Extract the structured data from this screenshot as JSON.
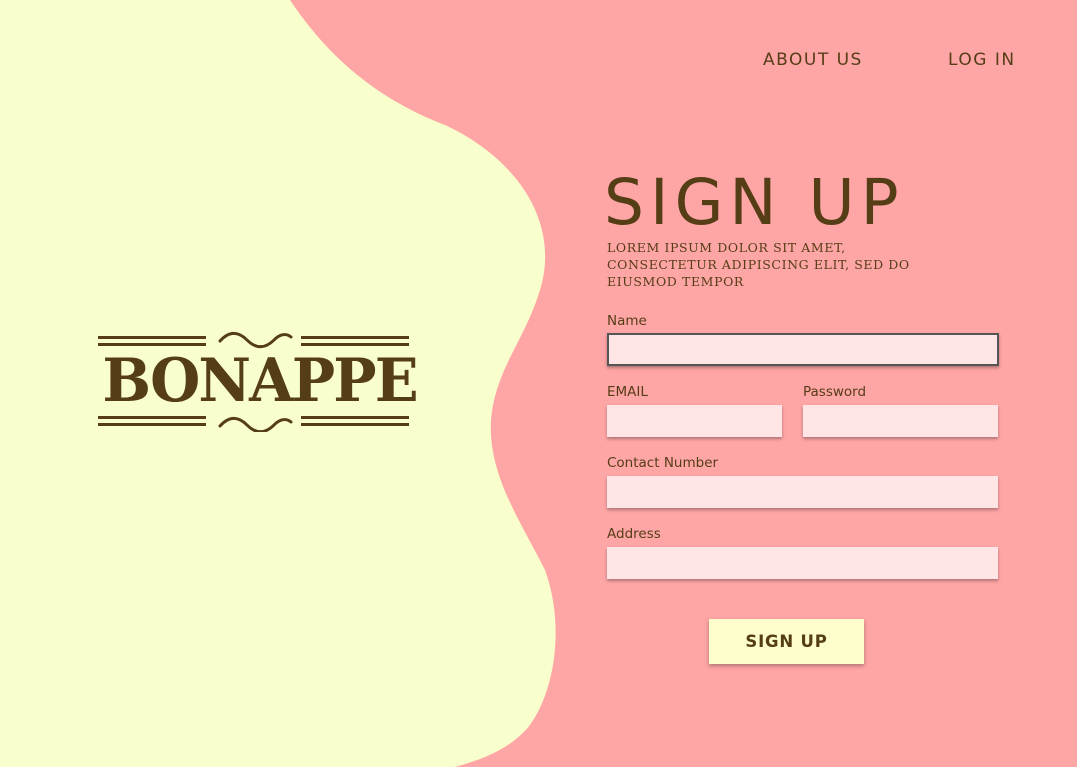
{
  "colors": {
    "background": "#fea5a5",
    "blob": "#f8fecc",
    "text": "#553d16",
    "field": "#ffe5e5",
    "button": "#fdfecc"
  },
  "logo": {
    "text": "BONAPPE"
  },
  "nav": {
    "about": "ABOUT US",
    "login": "LOG IN"
  },
  "heading": {
    "title": "SIGN UP",
    "subtitle": "Lorem ipsum dolor sit amet, consectetur adipiscing elit, sed do eiusmod tempor"
  },
  "form": {
    "name_label": "Name",
    "name_value": "",
    "email_label": "EMAIL",
    "email_value": "",
    "password_label": "Password",
    "password_value": "",
    "contact_label": "Contact Number",
    "contact_value": "",
    "address_label": "Address",
    "address_value": "",
    "submit_label": "SIGN UP"
  }
}
